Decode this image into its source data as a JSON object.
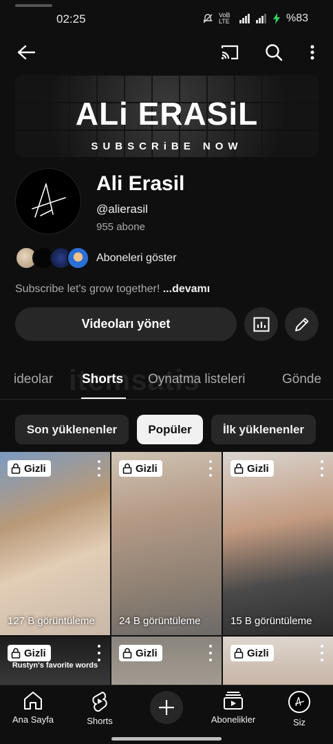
{
  "status": {
    "time": "02:25",
    "network": "VoB LTE",
    "battery": "%83"
  },
  "banner": {
    "title": "ALi ERASiL",
    "subtitle": "SUBSCRiBE NOW"
  },
  "channel": {
    "name": "Ali Erasil",
    "handle": "@alierasil",
    "subscribers": "955 abone",
    "subscribers_link": "Aboneleri göster",
    "description": "Subscribe let's grow together!",
    "more": "...devamı"
  },
  "actions": {
    "manage": "Videoları yönet"
  },
  "tabs": [
    {
      "label": "ideolar"
    },
    {
      "label": "Shorts",
      "active": true
    },
    {
      "label": "Oynatma listeleri"
    },
    {
      "label": "Gönde"
    }
  ],
  "watermark": "itemsatis",
  "chips": [
    {
      "label": "Son yüklenenler"
    },
    {
      "label": "Popüler",
      "active": true
    },
    {
      "label": "İlk yüklenenler"
    }
  ],
  "shorts": [
    {
      "badge": "Gizli",
      "views": "127 B görüntüleme"
    },
    {
      "badge": "Gizli",
      "views": "24 B görüntüleme"
    },
    {
      "badge": "Gizli",
      "views": "15 B görüntüleme"
    },
    {
      "badge": "Gizli",
      "caption": "Rustyn's favorite words"
    },
    {
      "badge": "Gizli"
    },
    {
      "badge": "Gizli"
    }
  ],
  "bottom_nav": [
    {
      "label": "Ana Sayfa",
      "icon": "home-icon"
    },
    {
      "label": "Shorts",
      "icon": "shorts-icon"
    },
    {
      "label": "",
      "icon": "plus-icon"
    },
    {
      "label": "Abonelikler",
      "icon": "subscriptions-icon"
    },
    {
      "label": "Siz",
      "icon": "profile-avatar"
    }
  ]
}
